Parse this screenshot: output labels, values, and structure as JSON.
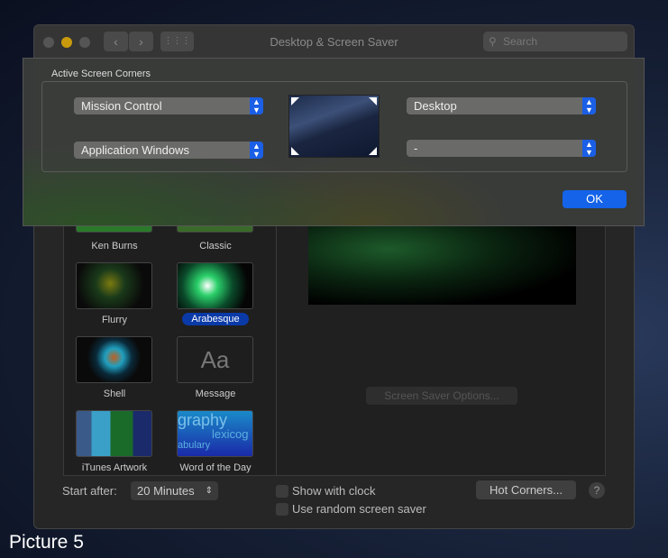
{
  "window": {
    "title": "Desktop & Screen Saver",
    "search_placeholder": "Search"
  },
  "screensavers": [
    {
      "label": "Ken Burns"
    },
    {
      "label": "Classic"
    },
    {
      "label": "Flurry"
    },
    {
      "label": "Arabesque",
      "selected": true
    },
    {
      "label": "Shell"
    },
    {
      "label": "Message",
      "thumb_text": "Aa"
    },
    {
      "label": "iTunes Artwork"
    },
    {
      "label": "Word of the Day",
      "thumb_words": [
        "graphy",
        "lexicog",
        "abulary"
      ]
    }
  ],
  "options": {
    "screen_saver_options": "Screen Saver Options...",
    "start_after_label": "Start after:",
    "start_after_value": "20 Minutes",
    "show_with_clock": "Show with clock",
    "show_with_clock_checked": false,
    "random": "Use random screen saver",
    "random_checked": false,
    "hot_corners": "Hot Corners...",
    "help": "?"
  },
  "sheet": {
    "title": "Active Screen Corners",
    "top_left": "Mission Control",
    "bottom_left": "Application Windows",
    "top_right": "Desktop",
    "bottom_right": "-",
    "ok": "OK"
  },
  "caption": "Picture 5",
  "colors": {
    "accent": "#1463e8",
    "selection": "#0a3aa8"
  }
}
